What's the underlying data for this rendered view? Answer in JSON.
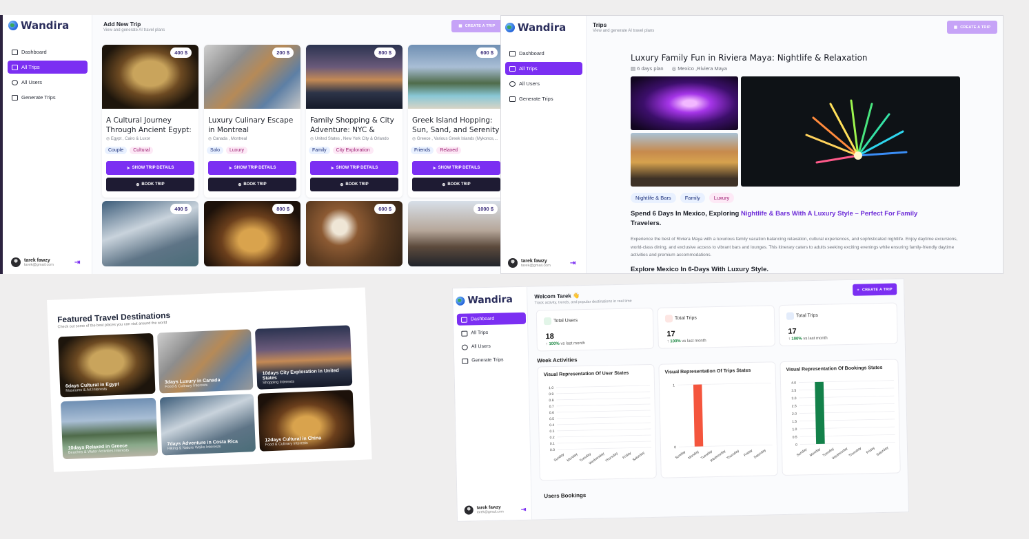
{
  "brand": {
    "name": "Wandira"
  },
  "user": {
    "name": "tarek fawzy",
    "email": "tarek@gmail.com",
    "email_alt": "tarek@gmail.com"
  },
  "nav": [
    {
      "label": "Dashboard",
      "icon": "grid-icon"
    },
    {
      "label": "All Trips",
      "icon": "map-icon"
    },
    {
      "label": "All Users",
      "icon": "users-icon"
    },
    {
      "label": "Generate Trips",
      "icon": "map-fold-icon"
    }
  ],
  "colors": {
    "accent": "#7b2ff2",
    "accent_light": "#c6a3f7",
    "dark": "#1e1b33",
    "chart_red": "#f4553d",
    "chart_green": "#13814a"
  },
  "add_trip": {
    "title": "Add New Trip",
    "subtitle": "View and generate AI travel plans",
    "create_label": "CREATE A TRIP",
    "show_label": "SHOW TRIP DETAILS",
    "book_label": "BOOK TRIP",
    "cards": [
      {
        "price": "400 $",
        "title": "A Cultural Journey Through Ancient Egypt: Museums ...",
        "location": "Egypt , Cairo & Luxor",
        "tags": [
          "Couple",
          "Cultural"
        ]
      },
      {
        "price": "200 $",
        "title": "Luxury Culinary Escape in Montreal",
        "location": "Canada , Montreal",
        "tags": [
          "Solo",
          "Luxury"
        ]
      },
      {
        "price": "800 $",
        "title": "Family Shopping & City Adventure: NYC & Orlando",
        "location": "United States , New York City & Orlando",
        "tags": [
          "Family",
          "City Exploration"
        ]
      },
      {
        "price": "600 $",
        "title": "Greek Island Hopping: Sun, Sand, and Serenity with...",
        "location": "Greece , Various Greek Islands (Mykonos,...",
        "tags": [
          "Friends",
          "Relaxed"
        ]
      }
    ],
    "row2_prices": [
      "400 $",
      "800 $",
      "600 $",
      "1000 $"
    ]
  },
  "trip_detail": {
    "header": "Trips",
    "subtitle": "View and generate AI travel plans",
    "create_label": "CREATE A TRIP",
    "title": "Luxury Family Fun in Riviera Maya: Nightlife & Relaxation",
    "duration": "6 days plan",
    "location": "Mexico ,Riviera Maya",
    "tags": [
      "Nightlife & Bars",
      "Family",
      "Luxury"
    ],
    "headline_pre": "Spend 6 Days In Mexico, Exploring ",
    "headline_hl": "Nightlife & Bars With A Luxury Style – Perfect For Family",
    "headline_post": "Travelers.",
    "description": "Experience the best of Riviera Maya with a luxurious family vacation balancing relaxation, cultural experiences, and sophisticated nightlife. Enjoy daytime excursions, world-class dining, and exclusive access to vibrant bars and lounges. This itinerary caters to adults seeking exciting evenings while ensuring family-friendly daytime activities and premium accommodations.",
    "subhead": "Explore Mexico In 6-Days With Luxury Style."
  },
  "featured": {
    "title": "Featured Travel Destinations",
    "subtitle": "Check out some of the best places you can visit around the world",
    "tiles": [
      {
        "title": "6days Cultural in Egypt",
        "sub": "Museums & Art Interests"
      },
      {
        "title": "3days Luxury in Canada",
        "sub": "Food & Culinary Interests"
      },
      {
        "title": "10days City Exploration in United States",
        "sub": "Shopping Interests"
      },
      {
        "title": "10days Relaxed in Greece",
        "sub": "Beaches & Water Activities Interests"
      },
      {
        "title": "7days Adventure in Costa Rica",
        "sub": "Hiking & Nature Walks Interests"
      },
      {
        "title": "12days Cultural in China",
        "sub": "Food & Culinary Interests"
      }
    ]
  },
  "dashboard": {
    "greeting": "Welcom Tarek 👋",
    "subtitle": "Track activity, trends, and popular destinations in real time",
    "create_label": "CREATE A TRIP",
    "stats": [
      {
        "label": "Total Users",
        "value": "18",
        "trend": "100%",
        "trend_suffix": "vs last month"
      },
      {
        "label": "Total Trips",
        "value": "17",
        "trend": "100%",
        "trend_suffix": "vs last month"
      },
      {
        "label": "Total Trips",
        "value": "17",
        "trend": "100%",
        "trend_suffix": "vs last month"
      }
    ],
    "section_week": "Week Activities",
    "section_bookings": "Users Bookings"
  },
  "chart_data": [
    {
      "type": "bar",
      "title": "Visual Representation Of User States",
      "categories": [
        "Sunday",
        "Monday",
        "Tuesday",
        "Wednesday",
        "Thursday",
        "Friday",
        "Saturday"
      ],
      "values": [
        0,
        0,
        0,
        0,
        0,
        0,
        0
      ],
      "yticks": [
        "1.0",
        "0.9",
        "0.8",
        "0.7",
        "0.6",
        "0.5",
        "0.4",
        "0.3",
        "0.2",
        "0.1",
        "0.0"
      ],
      "ylim": [
        0,
        1
      ],
      "color": "#f4553d"
    },
    {
      "type": "bar",
      "title": "Visual Representation Of Trips States",
      "categories": [
        "Sunday",
        "Monday",
        "Tuesday",
        "Wednesday",
        "Thursday",
        "Friday",
        "Saturday"
      ],
      "values": [
        0,
        1,
        0,
        0,
        0,
        0,
        0
      ],
      "yticks": [
        "1",
        "0"
      ],
      "ylim": [
        0,
        1
      ],
      "color": "#f4553d"
    },
    {
      "type": "bar",
      "title": "Visual Representation Of Bookings States",
      "categories": [
        "Sunday",
        "Monday",
        "Tuesday",
        "Wednesday",
        "Thursday",
        "Friday",
        "Saturday"
      ],
      "values": [
        0,
        4,
        0,
        0,
        0,
        0,
        0
      ],
      "yticks": [
        "4.0",
        "3.5",
        "3.0",
        "2.5",
        "2.0",
        "1.5",
        "1.0",
        "0.5",
        "0"
      ],
      "ylim": [
        0,
        4
      ],
      "color": "#13814a"
    }
  ]
}
